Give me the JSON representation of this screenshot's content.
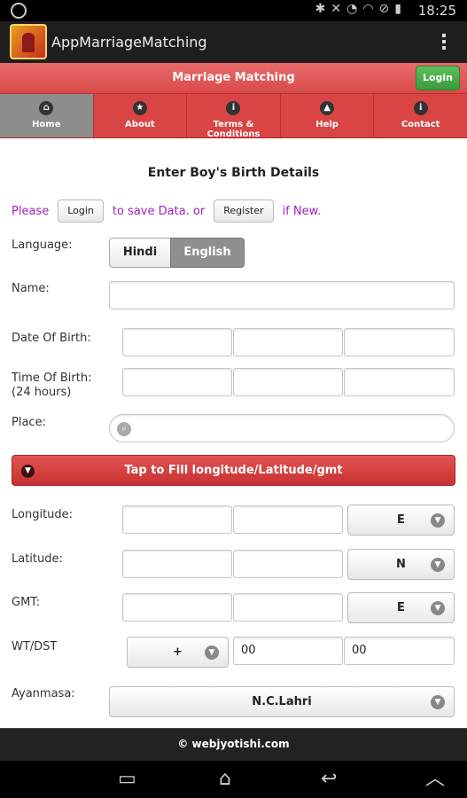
{
  "status_bar": {
    "time": "18:25"
  },
  "app": {
    "title": "AppMarriageMatching"
  },
  "header": {
    "title": "Marriage Matching",
    "login_label": "Login"
  },
  "nav": [
    {
      "label": "Home",
      "icon": "home-icon"
    },
    {
      "label": "About",
      "icon": "star-icon"
    },
    {
      "label": "Terms & Conditions",
      "icon": "info-icon"
    },
    {
      "label": "Help",
      "icon": "alert-icon"
    },
    {
      "label": "Contact",
      "icon": "info-icon"
    }
  ],
  "form": {
    "heading": "Enter Boy's Birth Details",
    "please": "Please",
    "login_btn": "Login",
    "mid_text": "to save Data. or",
    "register_btn": "Register",
    "if_new": "if New.",
    "language_label": "Language:",
    "lang_hindi": "Hindi",
    "lang_english": "English",
    "name_label": "Name:",
    "dob_label": "Date Of Birth:",
    "tob_label": "Time Of Birth:",
    "tob_sub": "(24 hours)",
    "place_label": "Place:",
    "tap_label": "Tap to Fill longitude/Latitude/gmt",
    "longitude_label": "Longitude:",
    "longitude_dir": "E",
    "latitude_label": "Latitude:",
    "latitude_dir": "N",
    "gmt_label": "GMT:",
    "gmt_dir": "E",
    "wtdst_label": "WT/DST",
    "wtdst_sign": "+",
    "wtdst_hours": "00",
    "wtdst_minutes": "00",
    "ayanmasa_label": "Ayanmasa:",
    "ayanmasa_value": "N.C.Lahri"
  },
  "footer": {
    "text": "© webjyotishi.com"
  }
}
